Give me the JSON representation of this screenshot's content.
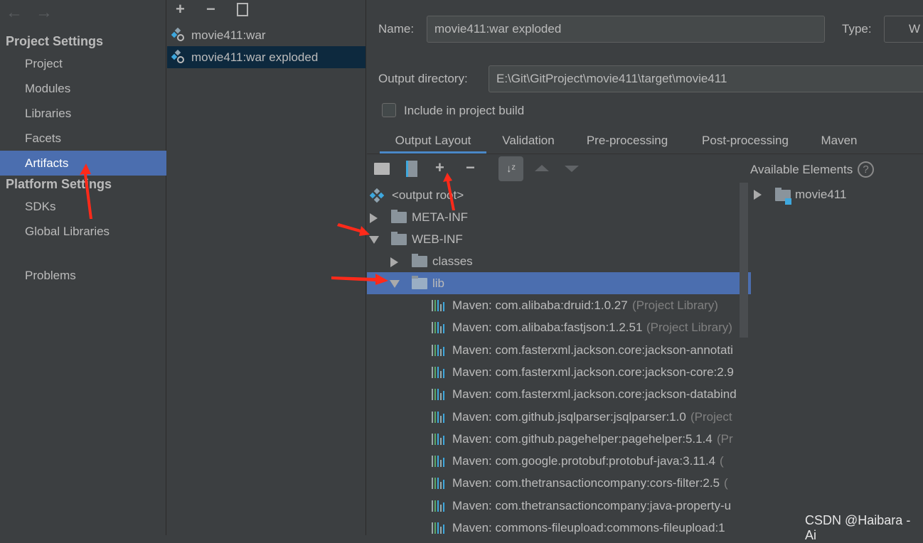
{
  "sidebar": {
    "back": "←",
    "forward": "→",
    "project_settings": "Project Settings",
    "items": [
      "Project",
      "Modules",
      "Libraries",
      "Facets",
      "Artifacts"
    ],
    "platform_settings": "Platform Settings",
    "platform_items": [
      "SDKs",
      "Global Libraries"
    ],
    "problems": "Problems",
    "selected": "Artifacts"
  },
  "artifacts": {
    "add": "+",
    "remove": "−",
    "items": [
      "movie411:war",
      "movie411:war exploded"
    ],
    "selected": "movie411:war exploded"
  },
  "main": {
    "name_label": "Name:",
    "name_value": "movie411:war exploded",
    "type_label": "Type:",
    "type_value": "W",
    "output_label": "Output directory:",
    "output_value": "E:\\Git\\GitProject\\movie411\\target\\movie411",
    "include_label": "Include in project build",
    "include_checked": false,
    "tabs": [
      "Output Layout",
      "Validation",
      "Pre-processing",
      "Post-processing",
      "Maven"
    ],
    "active_tab": "Output Layout",
    "available_label": "Available Elements",
    "available_items": [
      "movie411"
    ],
    "tree": {
      "root": "<output root>",
      "meta": "META-INF",
      "web": "WEB-INF",
      "classes": "classes",
      "lib": "lib",
      "libs": [
        {
          "name": "Maven: com.alibaba:druid:1.0.27",
          "suffix": "(Project Library)"
        },
        {
          "name": "Maven: com.alibaba:fastjson:1.2.51",
          "suffix": "(Project Library)"
        },
        {
          "name": "Maven: com.fasterxml.jackson.core:jackson-annotati",
          "suffix": ""
        },
        {
          "name": "Maven: com.fasterxml.jackson.core:jackson-core:2.9",
          "suffix": ""
        },
        {
          "name": "Maven: com.fasterxml.jackson.core:jackson-databind",
          "suffix": ""
        },
        {
          "name": "Maven: com.github.jsqlparser:jsqlparser:1.0",
          "suffix": "(Project"
        },
        {
          "name": "Maven: com.github.pagehelper:pagehelper:5.1.4",
          "suffix": "(Pr"
        },
        {
          "name": "Maven: com.google.protobuf:protobuf-java:3.11.4",
          "suffix": "("
        },
        {
          "name": "Maven: com.thetransactioncompany:cors-filter:2.5",
          "suffix": "("
        },
        {
          "name": "Maven: com.thetransactioncompany:java-property-u",
          "suffix": ""
        },
        {
          "name": "Maven: commons-fileupload:commons-fileupload:1",
          "suffix": ""
        }
      ]
    }
  },
  "watermark": "CSDN @Haibara - Ai",
  "colors": {
    "selection": "#4b6eaf",
    "accent": "#4a88c7",
    "annotation": "#ff2a1a"
  }
}
